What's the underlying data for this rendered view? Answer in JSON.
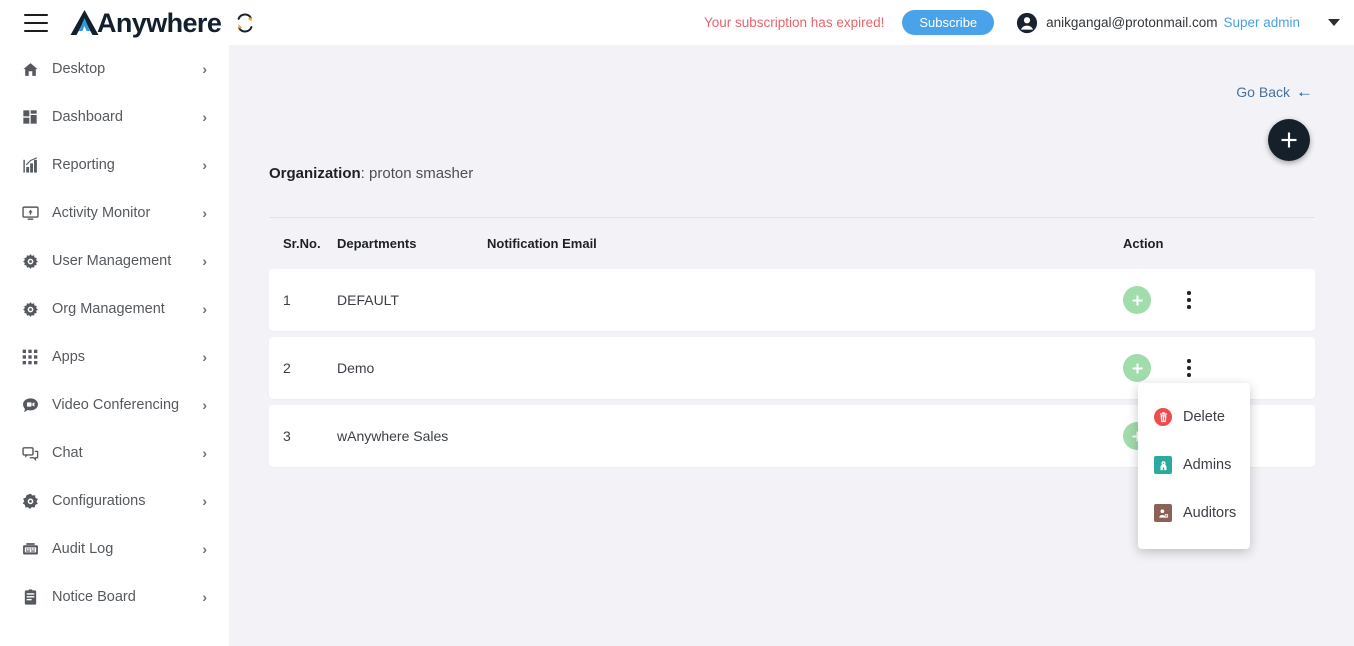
{
  "topbar": {
    "menu_icon": "hamburger-icon",
    "brand_name": "Anywhere",
    "refresh_icon": "refresh-icon",
    "expired_notice": "Your subscription has expired!",
    "subscribe_label": "Subscribe",
    "avatar_icon": "account-circle-icon",
    "user_email": "anikgangal@protonmail.com",
    "user_role": "Super admin",
    "caret_icon": "chevron-down-icon",
    "colors": {
      "expired": "#e8646a",
      "subscribe_bg": "#4aa3e8",
      "role": "#4a9fe0",
      "brand_accent": "#2e9bdf"
    }
  },
  "sidebar": {
    "items": [
      {
        "label": "Desktop",
        "icon": "home-icon",
        "arrow": "›"
      },
      {
        "label": "Dashboard",
        "icon": "dashboard-icon",
        "arrow": "›"
      },
      {
        "label": "Reporting",
        "icon": "bar-chart-icon",
        "arrow": "›"
      },
      {
        "label": "Activity Monitor",
        "icon": "monitor-icon",
        "arrow": "›"
      },
      {
        "label": "User Management",
        "icon": "gear-icon",
        "arrow": "›"
      },
      {
        "label": "Org Management",
        "icon": "gear-icon",
        "arrow": "›"
      },
      {
        "label": "Apps",
        "icon": "apps-grid-icon",
        "arrow": "›"
      },
      {
        "label": "Video Conferencing",
        "icon": "video-chat-icon",
        "arrow": "›"
      },
      {
        "label": "Chat",
        "icon": "chat-bubbles-icon",
        "arrow": "›"
      },
      {
        "label": "Configurations",
        "icon": "settings-gear-icon",
        "arrow": "›"
      },
      {
        "label": "Audit Log",
        "icon": "audit-log-icon",
        "arrow": "›"
      },
      {
        "label": "Notice Board",
        "icon": "notice-board-icon",
        "arrow": "›"
      }
    ]
  },
  "main": {
    "go_back_label": "Go Back",
    "go_back_arrow": "←",
    "add_fab_icon": "plus-icon",
    "organization_label": "Organization",
    "organization_separator": ": ",
    "organization_name": "proton smasher",
    "table": {
      "columns": [
        "Sr.No.",
        "Departments",
        "Notification Email",
        "Action"
      ],
      "rows": [
        {
          "sr": "1",
          "department": "DEFAULT",
          "email": "",
          "add_icon": "plus-circle-icon",
          "menu_icon": "more-vertical-icon"
        },
        {
          "sr": "2",
          "department": "Demo",
          "email": "",
          "add_icon": "plus-circle-icon",
          "menu_icon": "more-vertical-icon"
        },
        {
          "sr": "3",
          "department": "wAnywhere Sales",
          "email": "",
          "add_icon": "plus-circle-icon",
          "menu_icon": "more-vertical-icon"
        }
      ]
    },
    "context_menu": {
      "items": [
        {
          "label": "Delete",
          "icon": "trash-icon",
          "color": "#ee4b4b"
        },
        {
          "label": "Admins",
          "icon": "admin-badge-icon",
          "color": "#2aab9e"
        },
        {
          "label": "Auditors",
          "icon": "auditor-icon",
          "color": "#8a6258"
        }
      ]
    }
  }
}
